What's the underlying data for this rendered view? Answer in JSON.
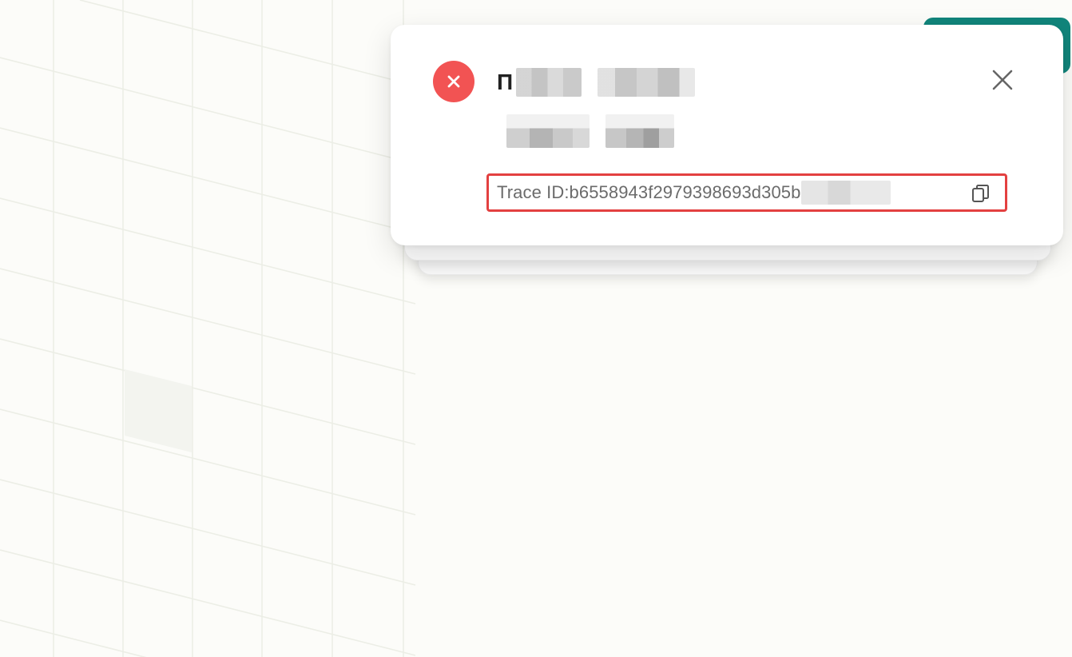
{
  "toast": {
    "type": "error",
    "title_visible_prefix": "П",
    "trace_label": "Trace ID: ",
    "trace_id_visible": "b6558943f2979398693d305b"
  },
  "icons": {
    "status": "error-x-icon",
    "close": "close-icon",
    "copy": "copy-icon"
  },
  "colors": {
    "error": "#f25353",
    "highlight_border": "#e34040",
    "background_button": "#11857b",
    "trace_text": "#6b6b6b"
  }
}
